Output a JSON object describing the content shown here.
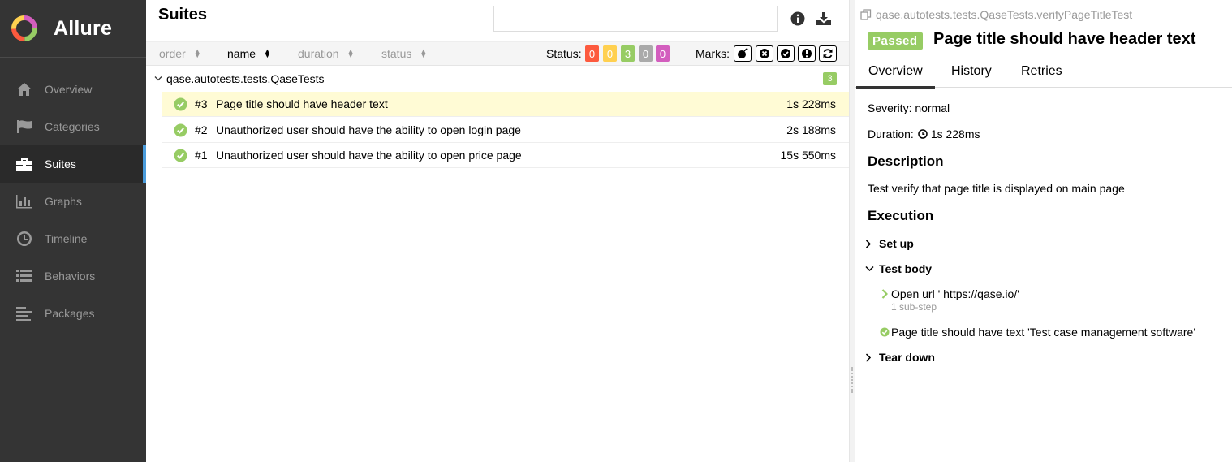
{
  "sidebar": {
    "brand": "Allure",
    "items": [
      {
        "label": "Overview",
        "icon": "home-icon"
      },
      {
        "label": "Categories",
        "icon": "flag-icon"
      },
      {
        "label": "Suites",
        "icon": "briefcase-icon",
        "active": true
      },
      {
        "label": "Graphs",
        "icon": "bar-chart-icon"
      },
      {
        "label": "Timeline",
        "icon": "clock-icon"
      },
      {
        "label": "Behaviors",
        "icon": "list-icon"
      },
      {
        "label": "Packages",
        "icon": "packages-icon"
      }
    ]
  },
  "suites": {
    "title": "Suites",
    "search_value": "",
    "sort": {
      "order": "order",
      "name": "name",
      "duration": "duration",
      "status": "status"
    },
    "status_label": "Status:",
    "status_counts": [
      {
        "value": "0",
        "color": "#fd5a3e"
      },
      {
        "value": "0",
        "color": "#ffd050"
      },
      {
        "value": "3",
        "color": "#97cc64"
      },
      {
        "value": "0",
        "color": "#aaaaaa"
      },
      {
        "value": "0",
        "color": "#d35ebe"
      }
    ],
    "marks_label": "Marks:",
    "group": {
      "name": "qase.autotests.tests.QaseTests",
      "count": "3"
    },
    "rows": [
      {
        "num": "#3",
        "name": "Page title should have header text",
        "duration": "1s 228ms"
      },
      {
        "num": "#2",
        "name": "Unauthorized user should have the ability to open login page",
        "duration": "2s 188ms"
      },
      {
        "num": "#1",
        "name": "Unauthorized user should have the ability to open price page",
        "duration": "15s 550ms"
      }
    ]
  },
  "detail": {
    "full_name": "qase.autotests.tests.QaseTests.verifyPageTitleTest",
    "status": "Passed",
    "title": "Page title should have header text",
    "tabs": [
      "Overview",
      "History",
      "Retries"
    ],
    "severity": "Severity: normal",
    "duration_label": "Duration:",
    "duration_value": "1s 228ms",
    "description_heading": "Description",
    "description": "Test verify that page title is displayed on main page",
    "execution_heading": "Execution",
    "setup": "Set up",
    "test_body": "Test body",
    "step1_name": "Open url ' https://qase.io/'",
    "step1_sub": "1 sub-step",
    "step2_name": "Page title should have text 'Test case management software'",
    "teardown": "Tear down"
  },
  "colors": {
    "sidebar": "#343434",
    "accent": "#4b9cdb",
    "passed": "#97cc64",
    "selected_row": "#fffbd5"
  }
}
